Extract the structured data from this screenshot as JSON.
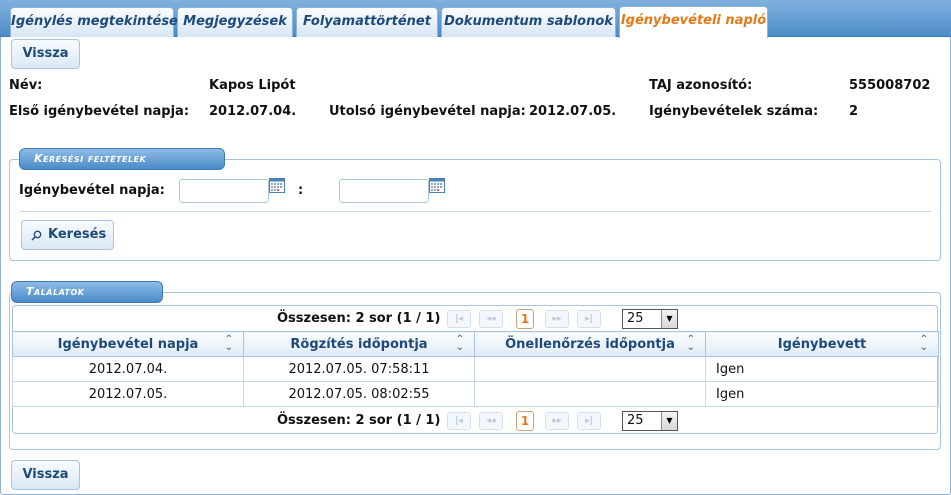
{
  "tabs": [
    {
      "label": "Igénylés megtekintése",
      "active": false
    },
    {
      "label": "Megjegyzések",
      "active": false
    },
    {
      "label": "Folyamattörténet",
      "active": false
    },
    {
      "label": "Dokumentum sablonok",
      "active": false
    },
    {
      "label": "Igénybevételi napló",
      "active": true
    }
  ],
  "back_button": "Vissza",
  "info": {
    "name_label": "Név:",
    "name_value": "Kapos Lipót",
    "taj_label": "TAJ azonosító:",
    "taj_value": "555008702",
    "first_label": "Első igénybevétel napja:",
    "first_value": "2012.07.04.",
    "last_label": "Utolsó igénybevétel napja:",
    "last_value": "2012.07.05.",
    "count_label": "Igénybevételek száma:",
    "count_value": "2"
  },
  "search": {
    "legend": "Keresési feltételek",
    "date_label": "Igénybevétel napja:",
    "range_separator": ":",
    "from_value": "",
    "to_value": "",
    "button": "Keresés"
  },
  "results": {
    "legend": "Találatok",
    "summary": "Összesen: 2 sor (1 / 1)",
    "current_page": "1",
    "page_size": "25",
    "columns": [
      "Igénybevétel napja",
      "Rögzítés időpontja",
      "Önellenőrzés időpontja",
      "Igénybevett"
    ],
    "rows": [
      [
        "2012.07.04.",
        "2012.07.05. 07:58:11",
        "",
        "Igen"
      ],
      [
        "2012.07.05.",
        "2012.07.05. 08:02:55",
        "",
        "Igen"
      ]
    ]
  },
  "colors": {
    "accent": "#e77817",
    "tab_text": "#1d4a7a",
    "legend_bg": "#4b8bc9"
  },
  "icons": {
    "calendar": "calendar-icon",
    "search": "magnifier-icon",
    "sort": "sort-arrows-icon"
  }
}
